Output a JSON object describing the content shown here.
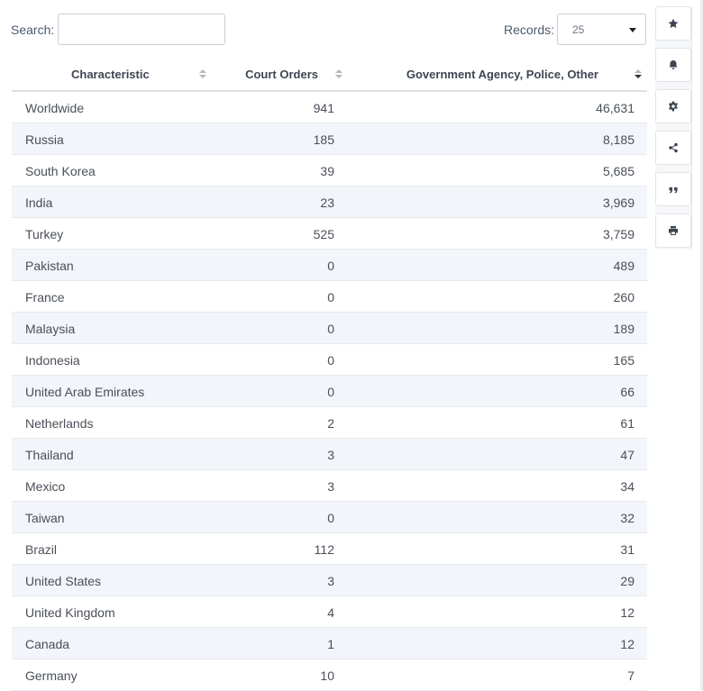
{
  "search": {
    "label": "Search:",
    "value": "",
    "placeholder": ""
  },
  "records": {
    "label": "Records:",
    "value": "25"
  },
  "table": {
    "headers": [
      "Characteristic",
      "Court Orders",
      "Government Agency, Police, Other"
    ],
    "rows": [
      [
        "Worldwide",
        "941",
        "46,631"
      ],
      [
        "Russia",
        "185",
        "8,185"
      ],
      [
        "South Korea",
        "39",
        "5,685"
      ],
      [
        "India",
        "23",
        "3,969"
      ],
      [
        "Turkey",
        "525",
        "3,759"
      ],
      [
        "Pakistan",
        "0",
        "489"
      ],
      [
        "France",
        "0",
        "260"
      ],
      [
        "Malaysia",
        "0",
        "189"
      ],
      [
        "Indonesia",
        "0",
        "165"
      ],
      [
        "United Arab Emirates",
        "0",
        "66"
      ],
      [
        "Netherlands",
        "2",
        "61"
      ],
      [
        "Thailand",
        "3",
        "47"
      ],
      [
        "Mexico",
        "3",
        "34"
      ],
      [
        "Taiwan",
        "0",
        "32"
      ],
      [
        "Brazil",
        "112",
        "31"
      ],
      [
        "United States",
        "3",
        "29"
      ],
      [
        "United Kingdom",
        "4",
        "12"
      ],
      [
        "Canada",
        "1",
        "12"
      ],
      [
        "Germany",
        "10",
        "7"
      ]
    ]
  },
  "toolbar": {
    "buttons": [
      {
        "name": "favorite",
        "icon": "star-icon"
      },
      {
        "name": "notification",
        "icon": "bell-icon"
      },
      {
        "name": "settings",
        "icon": "gear-icon"
      },
      {
        "name": "share",
        "icon": "share-icon"
      },
      {
        "name": "cite",
        "icon": "quote-icon"
      },
      {
        "name": "print",
        "icon": "printer-icon"
      }
    ]
  },
  "colors": {
    "alt_row": "#f2f5f9",
    "border": "#dde1e6",
    "text": "#4a4f58",
    "header_text": "#3e4652"
  }
}
